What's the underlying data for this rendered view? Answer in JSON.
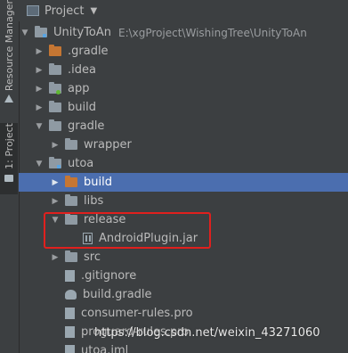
{
  "sidebar": {
    "tabs": [
      {
        "label": "Resource Manager"
      },
      {
        "label": "1: Project"
      }
    ]
  },
  "header": {
    "title": "Project"
  },
  "tree": {
    "rows": [
      {
        "label": "UnityToAn",
        "path": "E:\\xgProject\\WishingTree\\UnityToAn",
        "expanded": true,
        "icon": "module-folder-icon"
      },
      {
        "label": ".gradle",
        "expanded": false,
        "icon": "folder-icon"
      },
      {
        "label": ".idea",
        "expanded": false,
        "icon": "folder-icon"
      },
      {
        "label": "app",
        "expanded": false,
        "icon": "android-module-icon"
      },
      {
        "label": "build",
        "expanded": false,
        "icon": "folder-icon"
      },
      {
        "label": "gradle",
        "expanded": true,
        "icon": "folder-icon"
      },
      {
        "label": "wrapper",
        "expanded": false,
        "icon": "folder-icon"
      },
      {
        "label": "utoa",
        "expanded": true,
        "icon": "module-folder-icon"
      },
      {
        "label": "build",
        "expanded": false,
        "icon": "excluded-folder-icon",
        "selected": true
      },
      {
        "label": "libs",
        "expanded": false,
        "icon": "folder-icon"
      },
      {
        "label": "release",
        "expanded": true,
        "icon": "folder-icon"
      },
      {
        "label": "AndroidPlugin.jar",
        "icon": "jar-file-icon"
      },
      {
        "label": "src",
        "expanded": false,
        "icon": "folder-icon"
      },
      {
        "label": ".gitignore",
        "icon": "file-icon"
      },
      {
        "label": "build.gradle",
        "icon": "gradle-icon"
      },
      {
        "label": "consumer-rules.pro",
        "icon": "file-icon"
      },
      {
        "label": "proguard-rules.pro",
        "icon": "file-icon"
      },
      {
        "label": "utoa.iml",
        "icon": "file-icon"
      }
    ]
  },
  "watermark": "https://blog.csdn.net/weixin_43271060",
  "colors": {
    "background": "#3c3f41",
    "selection": "#4b6eaf",
    "highlight_box": "#e0201e",
    "excluded_folder": "#c57633"
  }
}
